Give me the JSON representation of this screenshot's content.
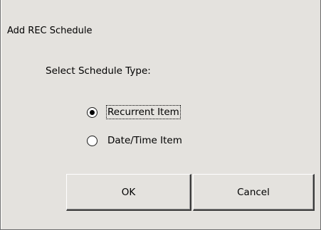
{
  "dialog": {
    "title": "Add REC Schedule",
    "prompt": "Select Schedule Type:",
    "options": [
      {
        "label": "Recurrent Item",
        "selected": true
      },
      {
        "label": "Date/Time Item",
        "selected": false
      }
    ],
    "buttons": {
      "ok_label": "OK",
      "cancel_label": "Cancel"
    }
  }
}
